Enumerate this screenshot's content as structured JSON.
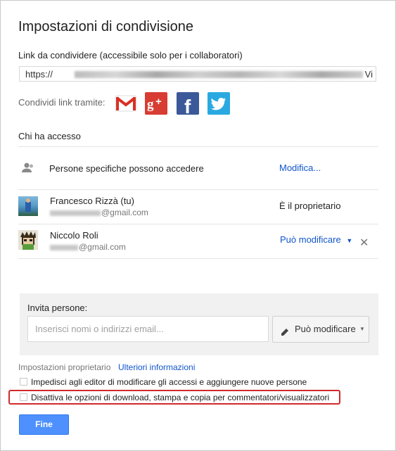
{
  "dialog": {
    "title": "Impostazioni di condivisione"
  },
  "link_section": {
    "label": "Link da condividere (accessibile solo per i collaboratori)",
    "value_start": "https://",
    "value_end": "Vi"
  },
  "share_via": {
    "label": "Condividi link tramite:",
    "services": [
      "gmail-icon",
      "google-plus-icon",
      "facebook-icon",
      "twitter-icon"
    ]
  },
  "access": {
    "label": "Chi ha accesso",
    "visibility_text": "Persone specifiche possono accedere",
    "visibility_action": "Modifica...",
    "people": [
      {
        "name": "Francesco Rizzà (tu)",
        "email_suffix": "@gmail.com",
        "role": "È il proprietario"
      },
      {
        "name": "Niccolo Roli",
        "email_suffix": "@gmail.com",
        "role": "Può modificare"
      }
    ]
  },
  "invite": {
    "label": "Invita persone:",
    "placeholder": "Inserisci nomi o indirizzi email...",
    "permission": "Può modificare"
  },
  "owner_settings": {
    "label": "Impostazioni proprietario",
    "more_info": "Ulteriori informazioni",
    "option1": "Impedisci agli editor di modificare gli accessi e aggiungere nuove persone",
    "option2": "Disattiva le opzioni di download, stampa e copia per commentatori/visualizzatori"
  },
  "footer": {
    "done_label": "Fine"
  },
  "colors": {
    "accent": "#15c",
    "primary_button": "#4d90fe",
    "highlight_border": "#d12a2a"
  }
}
